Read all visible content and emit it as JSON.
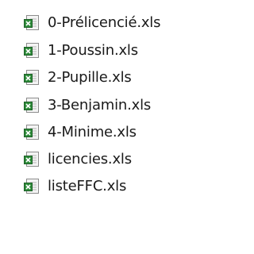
{
  "files": [
    {
      "name": "0-Prélicencié.xls",
      "icon": "excel-file-icon"
    },
    {
      "name": "1-Poussin.xls",
      "icon": "excel-file-icon"
    },
    {
      "name": "2-Pupille.xls",
      "icon": "excel-file-icon"
    },
    {
      "name": "3-Benjamin.xls",
      "icon": "excel-file-icon"
    },
    {
      "name": "4-Minime.xls",
      "icon": "excel-file-icon"
    },
    {
      "name": "licencies.xls",
      "icon": "excel-file-icon"
    },
    {
      "name": "listeFFC.xls",
      "icon": "excel-file-icon"
    }
  ],
  "colors": {
    "excel_green": "#2e8b3a",
    "page_border": "#8c8c8c",
    "page_fill": "#f4f4f4",
    "text": "#1a1a1a"
  }
}
